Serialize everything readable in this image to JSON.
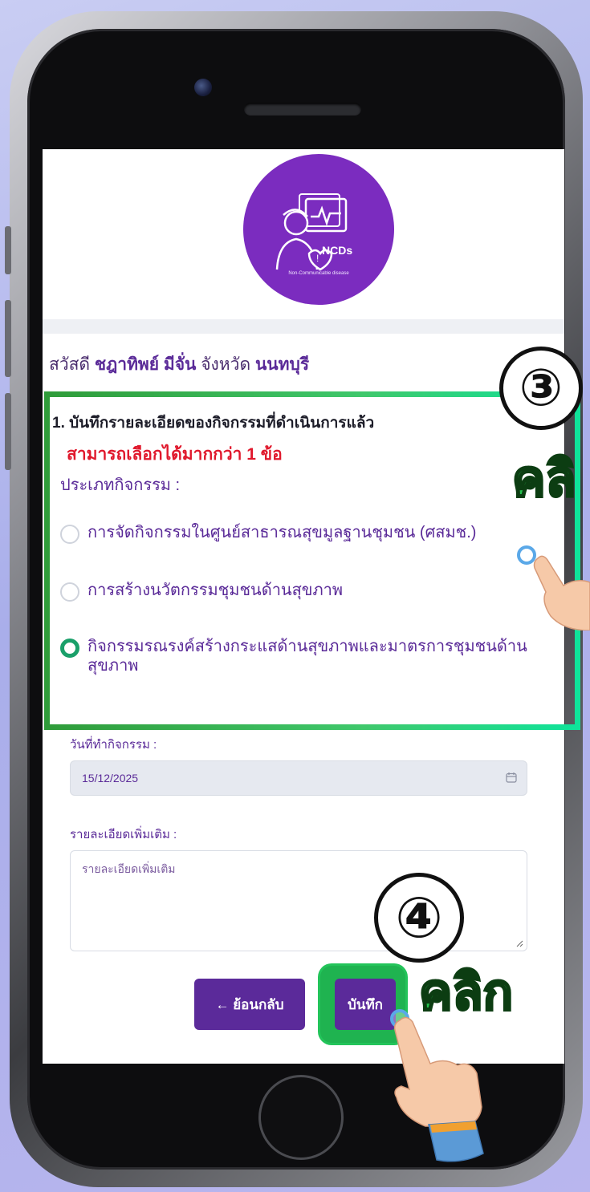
{
  "logo": {
    "brand": "NCDs",
    "subtitle": "Non-Communicable disease"
  },
  "greeting": {
    "prefix": "สวัสดี",
    "name": "ชฎาทิพย์ มีจั่น",
    "province_label": "จังหวัด",
    "province": "นนทบุรี"
  },
  "question": {
    "title": "1. บันทึกรายละเอียดของกิจกรรมที่ดำเนินการแล้ว",
    "note": "สามารถเลือกได้มากกว่า 1 ข้อ",
    "type_label": "ประเภทกิจกรรม :",
    "options": [
      {
        "label": "การจัดกิจกรรมในศูนย์สาธารณสุขมูลฐานชุมชน (ศสมช.)",
        "checked": false
      },
      {
        "label": "การสร้างนวัตกรรมชุมชนด้านสุขภาพ",
        "checked": false
      },
      {
        "label": "กิจกรรมรณรงค์สร้างกระแสด้านสุขภาพและมาตรการชุมชนด้านสุขภาพ",
        "checked": true
      }
    ]
  },
  "date_field": {
    "label": "วันที่ทำกิจกรรม :",
    "value": "15/12/2025"
  },
  "details_field": {
    "label": "รายละเอียดเพิ่มเติม :",
    "placeholder": "รายละเอียดเพิ่มเติม"
  },
  "buttons": {
    "back": "← ย้อนกลับ",
    "save": "บันทึก"
  },
  "annotations": {
    "step3_number": "③",
    "step3_text": "คลิ",
    "step4_number": "④",
    "step4_text": "คลิก",
    "highlight_color": "#3fc86c"
  }
}
